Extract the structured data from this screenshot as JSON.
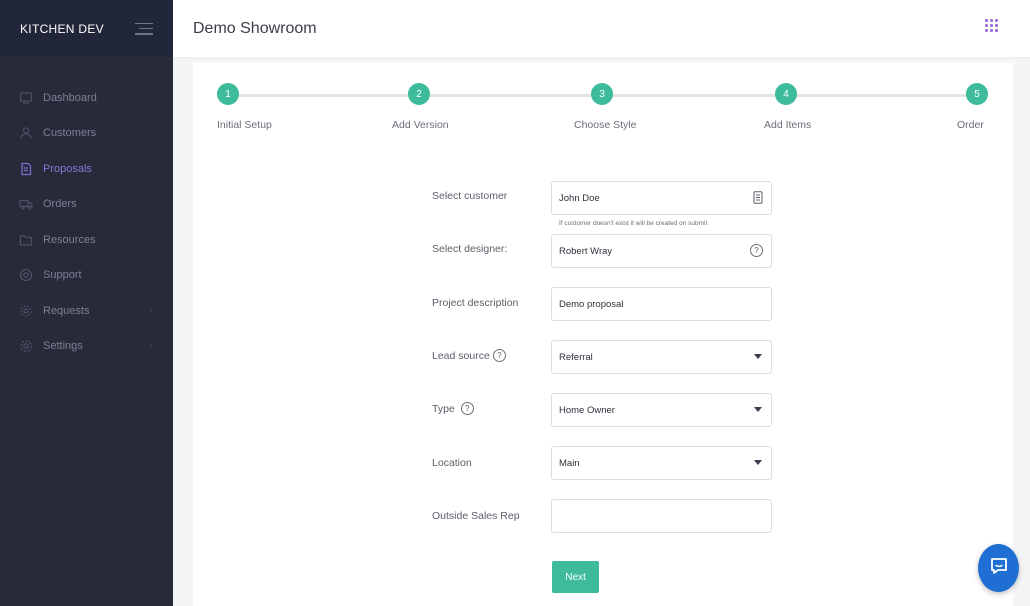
{
  "sidebar": {
    "brand": "KITCHEN DEV",
    "items": [
      {
        "label": "Dashboard",
        "icon": "dashboard-icon"
      },
      {
        "label": "Customers",
        "icon": "user-icon"
      },
      {
        "label": "Proposals",
        "icon": "document-icon",
        "active": true
      },
      {
        "label": "Orders",
        "icon": "truck-icon"
      },
      {
        "label": "Resources",
        "icon": "folder-icon"
      },
      {
        "label": "Support",
        "icon": "lifebuoy-icon"
      },
      {
        "label": "Requests",
        "icon": "gear-icon",
        "has_submenu": true
      },
      {
        "label": "Settings",
        "icon": "settings-icon",
        "has_submenu": true
      }
    ]
  },
  "header": {
    "title": "Demo Showroom"
  },
  "stepper": {
    "steps": [
      {
        "number": "1",
        "label": "Initial Setup"
      },
      {
        "number": "2",
        "label": "Add Version"
      },
      {
        "number": "3",
        "label": "Choose Style"
      },
      {
        "number": "4",
        "label": "Add Items"
      },
      {
        "number": "5",
        "label": "Order"
      }
    ]
  },
  "form": {
    "customer": {
      "label": "Select customer",
      "value": "John Doe",
      "hint": "If customer doesn't exist it will be created on submit"
    },
    "designer": {
      "label": "Select designer:",
      "value": "Robert Wray"
    },
    "description": {
      "label": "Project description",
      "value": "Demo proposal"
    },
    "lead_source": {
      "label": "Lead source",
      "value": "Referral"
    },
    "type": {
      "label": "Type",
      "value": "Home Owner"
    },
    "location": {
      "label": "Location",
      "value": "Main"
    },
    "outside_sales_rep": {
      "label": "Outside Sales Rep",
      "value": ""
    },
    "next_label": "Next"
  },
  "colors": {
    "accent": "#3dbb9b",
    "sidebar_bg": "#262a39",
    "active_nav": "#8a78d9",
    "chat_blue": "#1f6ed4"
  }
}
